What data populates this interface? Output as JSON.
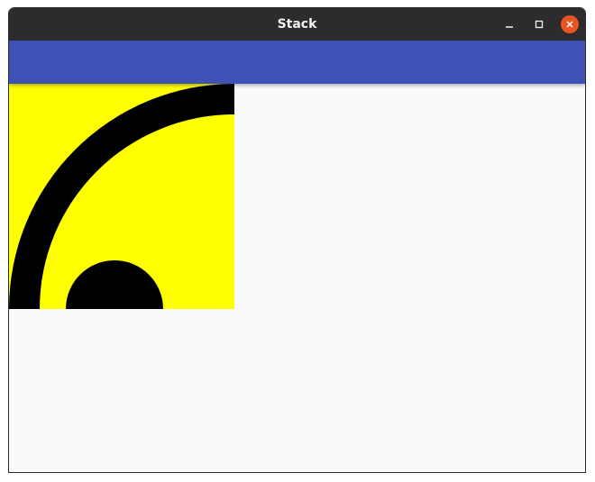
{
  "window": {
    "title": "Stack",
    "controls": {
      "minimize_icon": "minimize-icon",
      "maximize_icon": "maximize-icon",
      "close_icon": "close-icon"
    }
  },
  "app_bar": {
    "color": "#3f51b5"
  },
  "stack": {
    "background_color": "#ffff00",
    "shape_color": "#000000"
  },
  "colors": {
    "titlebar": "#2c2c2c",
    "close_button": "#e95420",
    "content_background": "#fafafa"
  }
}
